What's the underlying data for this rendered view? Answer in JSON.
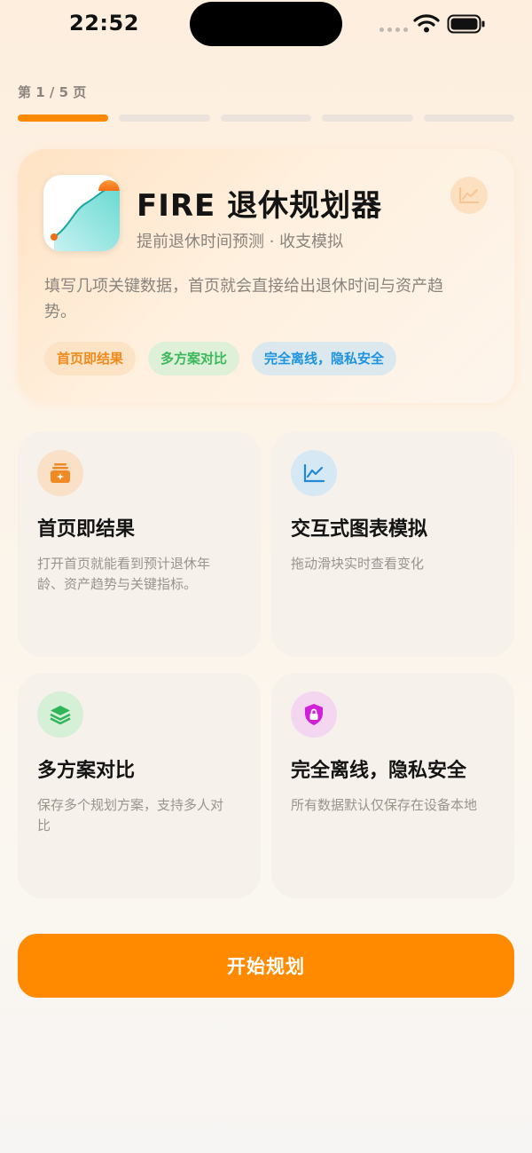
{
  "status_bar": {
    "time": "22:52"
  },
  "progress": {
    "label": "第 1 / 5 页",
    "current": 1,
    "total": 5
  },
  "hero": {
    "title": "FIRE 退休规划器",
    "subtitle": "提前退休时间预测 · 收支模拟",
    "description": "填写几项关键数据，首页就会直接给出退休时间与资产趋势。",
    "chips": [
      "首页即结果",
      "多方案对比",
      "完全离线，隐私安全"
    ]
  },
  "features": [
    {
      "title": "首页即结果",
      "description": "打开首页就能看到预计退休年龄、资产趋势与关键指标。",
      "icon": "sparkle-stack-icon",
      "color": "#f08a24"
    },
    {
      "title": "交互式图表模拟",
      "description": "拖动滑块实时查看变化",
      "icon": "line-chart-icon",
      "color": "#2189d8"
    },
    {
      "title": "多方案对比",
      "description": "保存多个规划方案，支持多人对比",
      "icon": "layers-icon",
      "color": "#2fb55a"
    },
    {
      "title": "完全离线，隐私安全",
      "description": "所有数据默认仅保存在设备本地",
      "icon": "lock-shield-icon",
      "color": "#d21fd8"
    }
  ],
  "cta": {
    "label": "开始规划"
  },
  "colors": {
    "accent": "#ff8a00",
    "text": "#141414",
    "muted": "#8a847d"
  }
}
